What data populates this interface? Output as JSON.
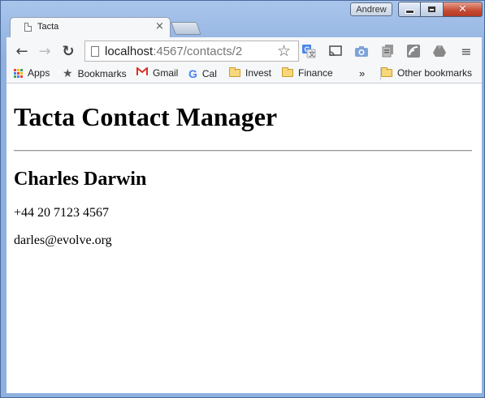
{
  "window": {
    "user_label": "Andrew",
    "min_label": "minimize",
    "max_label": "maximize",
    "close_label": "close"
  },
  "tab": {
    "title": "Tacta",
    "close_glyph": "×"
  },
  "toolbar": {
    "back_glyph": "←",
    "forward_glyph": "→",
    "reload_glyph": "↻",
    "url_host": "localhost",
    "url_rest": ":4567/contacts/2",
    "star_glyph": "☆",
    "menu_glyph": "≡"
  },
  "bookmarks": {
    "items": [
      {
        "label": "Apps",
        "icon": "apps-grid-icon"
      },
      {
        "label": "Bookmarks",
        "icon": "star-icon"
      },
      {
        "label": "Gmail",
        "icon": "gmail-icon"
      },
      {
        "label": "Cal",
        "icon": "google-icon"
      },
      {
        "label": "Invest",
        "icon": "folder-icon"
      },
      {
        "label": "Finance",
        "icon": "folder-icon"
      }
    ],
    "overflow_glyph": "»",
    "other_label": "Other bookmarks"
  },
  "page": {
    "heading": "Tacta Contact Manager",
    "contact": {
      "name": "Charles Darwin",
      "phone": "+44 20 7123 4567",
      "email": "darles@evolve.org"
    }
  },
  "colors": {
    "frame": "#a9c5ec",
    "close": "#c64a33",
    "toolbar": "#f6f7f9"
  }
}
